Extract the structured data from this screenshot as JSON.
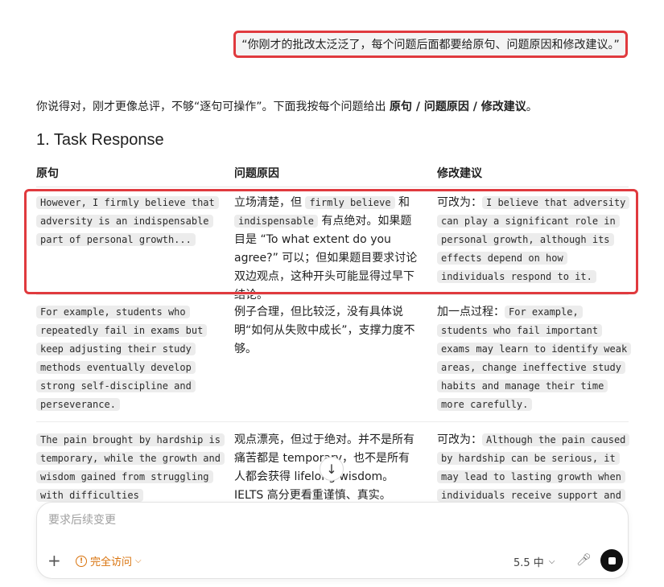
{
  "user_message": "“你刚才的批改太泛泛了，每个问题后面都要给原句、问题原因和修改建议。”",
  "intro": {
    "text": "你说得对，刚才更像总评，不够“逐句可操作”。下面我按每个问题给出 ",
    "bold": "原句 / 问题原因 / 修改建议",
    "end": "。"
  },
  "section_title": "1. Task Response",
  "table": {
    "headers": [
      "原句",
      "问题原因",
      "修改建议"
    ],
    "row1": {
      "original": "However, I firmly believe that adversity is an indispensable part of personal growth...",
      "reason_a": "立场清楚，但 ",
      "reason_code1": "firmly believe",
      "reason_b": " 和 ",
      "reason_code2": "indispensable",
      "reason_c": " 有点绝对。如果题目是 “To what extent do you agree?” 可以；但如果题目要求讨论双边观点，这种开头可能显得过早下结论。",
      "suggest_prefix": "可改为：",
      "suggest_code": "I believe that adversity can play a significant role in personal growth, although its effects depend on how individuals respond to it."
    },
    "row2": {
      "original": "For example, students who repeatedly fail in exams but keep adjusting their study methods eventually develop strong self-discipline and perseverance.",
      "reason": "例子合理，但比较泛，没有具体说明“如何从失败中成长”，支撑力度不够。",
      "suggest_prefix": "加一点过程：",
      "suggest_code": "For example, students who fail important exams may learn to identify weak areas, change ineffective study habits and manage their time more carefully."
    },
    "row3": {
      "original": "The pain brought by hardship is temporary, while the growth and wisdom gained from struggling with difficulties",
      "reason": "观点漂亮，但过于绝对。并不是所有痛苦都是 temporary，也不是所有人都会获得 lifelong wisdom。IELTS 高分更看重谨慎、真实。",
      "suggest_prefix": "可改为：",
      "suggest_code": "Although the pain caused by hardship can be serious, it may lead to lasting growth when individuals receive support and"
    }
  },
  "composer": {
    "placeholder": "要求后续变更",
    "access_label": "完全访问",
    "model_label": "5.5 中"
  },
  "icons": {
    "scroll": "arrow-down-icon",
    "plus": "plus-icon",
    "warn": "warning-icon",
    "mic": "mic-icon",
    "stop": "stop-icon"
  }
}
